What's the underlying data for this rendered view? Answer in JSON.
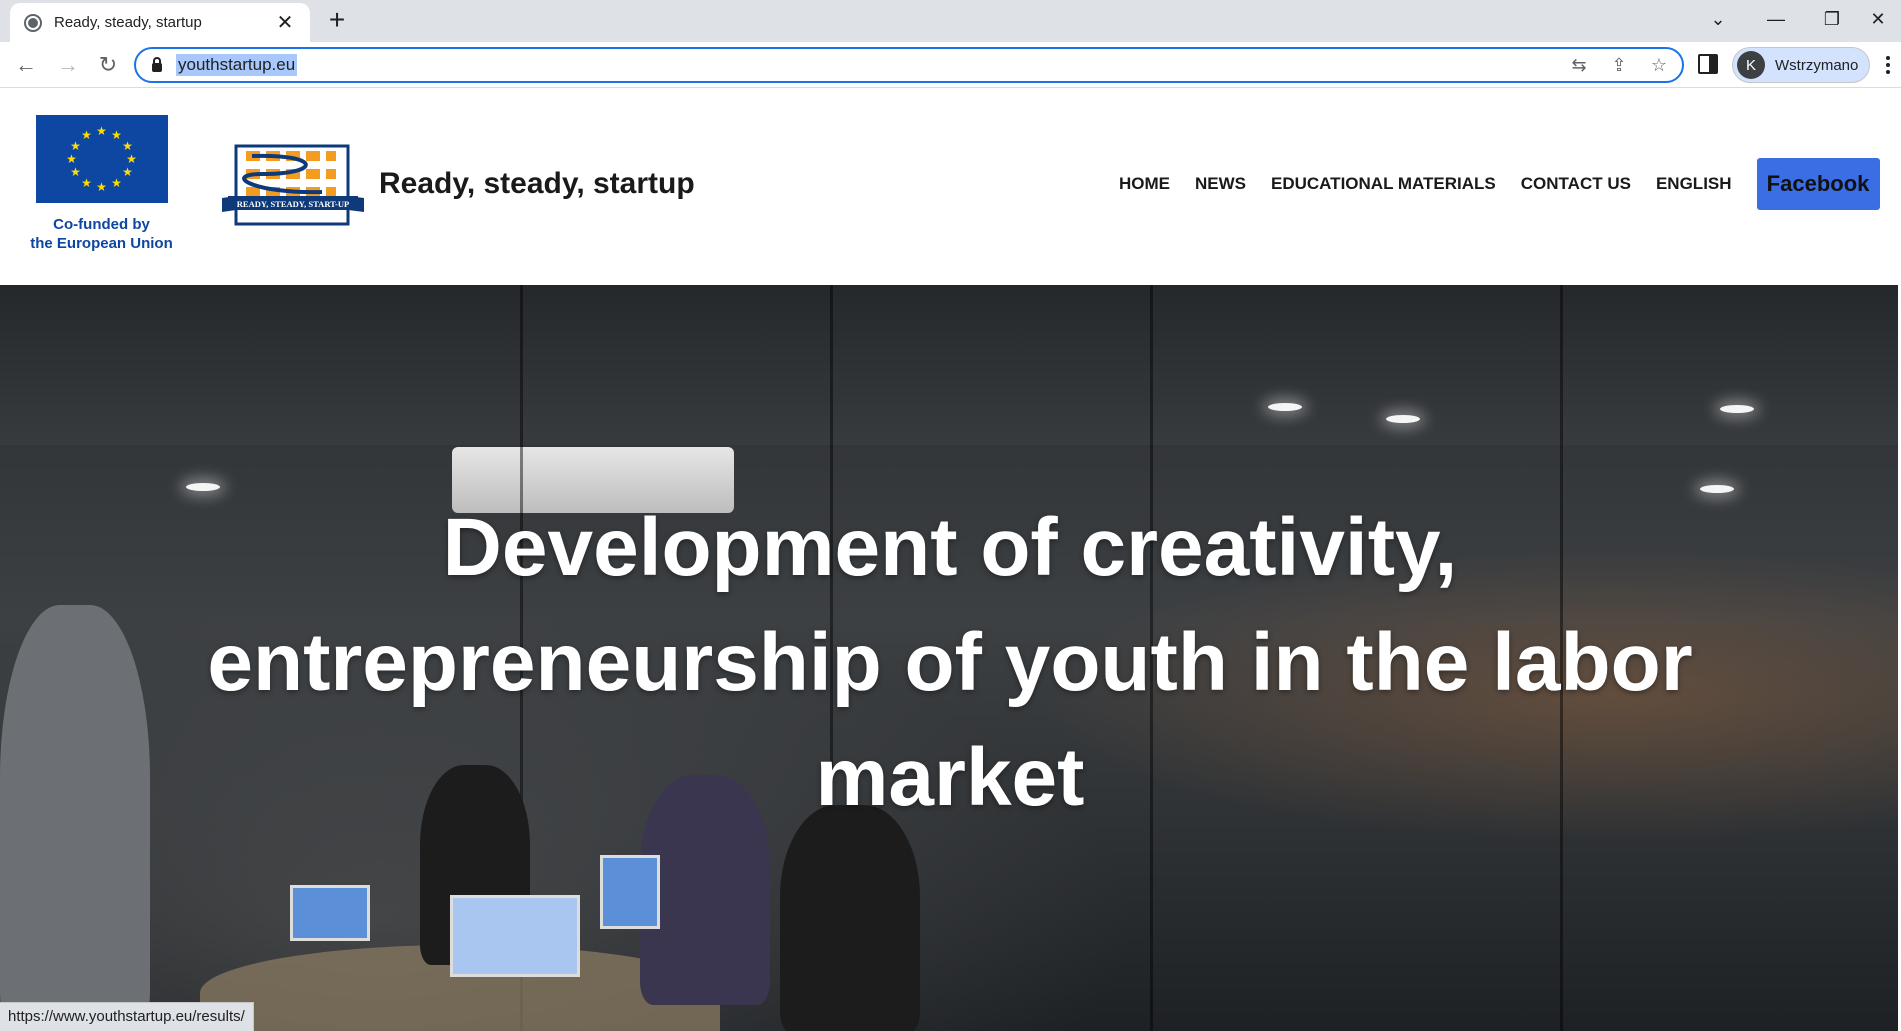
{
  "browser": {
    "tab_title": "Ready, steady, startup",
    "url": "youthstartup.eu",
    "profile_initial": "K",
    "profile_label": "Wstrzymano",
    "status_url": "https://www.youthstartup.eu/results/"
  },
  "header": {
    "eu_caption_line1": "Co-funded by",
    "eu_caption_line2": "the European Union",
    "site_title": "Ready, steady, startup",
    "project_logo_text": "READY, STEADY, START-UP",
    "nav": [
      {
        "label": "HOME"
      },
      {
        "label": "NEWS"
      },
      {
        "label": "EDUCATIONAL MATERIALS"
      },
      {
        "label": "CONTACT US"
      },
      {
        "label": "ENGLISH"
      }
    ],
    "facebook_label": "Facebook"
  },
  "hero": {
    "title": "Development of creativity, entrepreneurship of youth in the labor market"
  },
  "colors": {
    "eu_blue": "#0e47a1",
    "facebook_button": "#3b6de4",
    "omnibox_focus": "#1a73e8"
  }
}
